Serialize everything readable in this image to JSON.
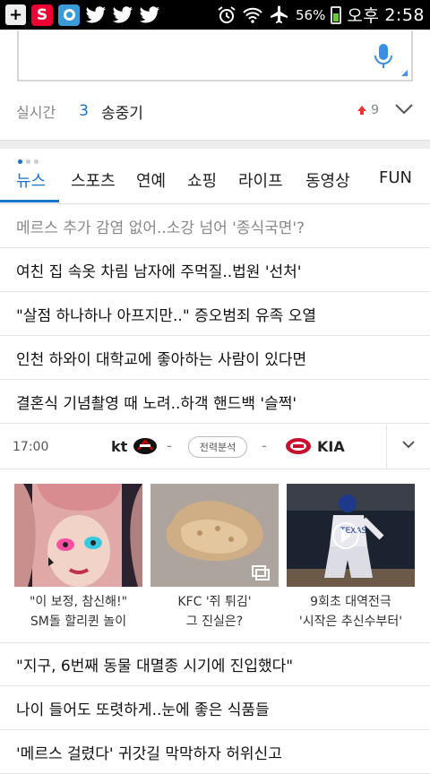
{
  "status_bar": {
    "battery": "56%",
    "ampm": "오후",
    "time": "2:58",
    "left_icons": [
      "plus-icon",
      "s-app-icon",
      "o-app-icon",
      "twitter-icon",
      "twitter-icon",
      "twitter-icon"
    ],
    "right_icons": [
      "alarm-icon",
      "wifi-icon",
      "airplane-icon",
      "battery-icon"
    ]
  },
  "search": {
    "placeholder": ""
  },
  "realtime": {
    "label": "실시간",
    "rank": "3",
    "term": "송중기",
    "change": "9"
  },
  "tabs": [
    "뉴스",
    "스포츠",
    "연예",
    "쇼핑",
    "라이프",
    "동영상",
    "FUN"
  ],
  "news": [
    "메르스 추가 감염 없어..소강 넘어 '종식국면'?",
    "여친 집 속옷 차림 남자에 주먹질..법원 '선처'",
    "\"살점 하나하나 아프지만..\" 증오범죄 유족 오열",
    "인천 하와이 대학교에 좋아하는 사람이 있다면",
    "결혼식 기념촬영 때 노려..하객 핸드백 '슬쩍'"
  ],
  "baseball": {
    "time": "17:00",
    "home_team": "kt",
    "away_team": "KIA",
    "home_score": "-",
    "away_score": "-",
    "analysis_label": "전력분석"
  },
  "cards": [
    {
      "line1": "\"이 보정, 참신해!\"",
      "line2": "SM돌 할리퀸 놀이"
    },
    {
      "line1": "KFC '쥐 튀김'",
      "line2": "그 진실은?"
    },
    {
      "line1": "9회초 대역전극",
      "line2": "'시작은 추신수부터'"
    }
  ],
  "news2": [
    "\"지구, 6번째 동물 대멸종 시기에 진입했다\"",
    "나이 들어도 또렷하게..눈에 좋은 식품들",
    "'메르스 걸렸다' 귀갓길 막막하자 허위신고"
  ],
  "colors": {
    "accent": "#1a73c8",
    "up_arrow": "#e33333"
  }
}
